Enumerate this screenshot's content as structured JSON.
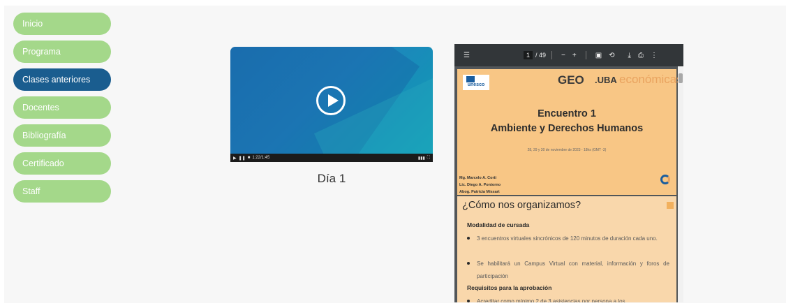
{
  "nav": [
    {
      "label": "Inicio",
      "active": false
    },
    {
      "label": "Programa",
      "active": false
    },
    {
      "label": "Clases anteriores",
      "active": true
    },
    {
      "label": "Docentes",
      "active": false
    },
    {
      "label": "Bibliografía",
      "active": false
    },
    {
      "label": "Certificado",
      "active": false
    },
    {
      "label": "Staff",
      "active": false
    }
  ],
  "video": {
    "title": "Día 1",
    "time": "1:22/1:45"
  },
  "pdf": {
    "toolbar": {
      "current_page": "1",
      "total": "/ 49"
    },
    "slide1": {
      "logo_unesco": "unesco",
      "logo_geo": "GEO",
      "logo_uba": ".UBA",
      "logo_eco": "económicas",
      "title_line1": "Encuentro 1",
      "title_line2": "Ambiente y Derechos Humanos",
      "dates": "28, 29 y 30 de noviembre de 2023 - 18hs (GMT -3)",
      "authors": [
        "Mg. Marcelo A. Corti",
        "Lic. Diego A. Pontorno",
        "Abog. Patricia Missart"
      ]
    },
    "slide2": {
      "heading": "¿Cómo nos organizamos?",
      "sub1": "Modalidad de cursada",
      "bullet1": "3 encuentros virtuales sincrónicos de 120 minutos de duración cada uno.",
      "bullet2": "Se habilitará un Campus Virtual con material, información y foros de participación",
      "sub2": "Requisitos para la aprobación",
      "bullet3": "Acreditar como mínimo 2 de 3 asistencias por persona a los"
    }
  },
  "colors": {
    "nav_green": "#a4d88a",
    "nav_active": "#1a5d8f",
    "slide_orange": "#f8c685"
  }
}
